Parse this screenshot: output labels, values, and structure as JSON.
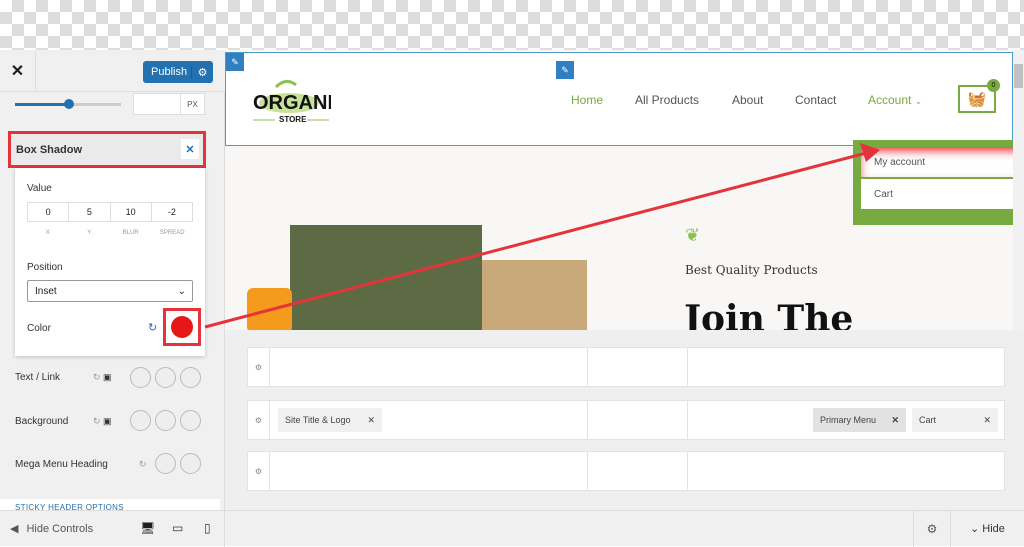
{
  "sidebar": {
    "publish_label": "Publish",
    "px_unit": "PX",
    "slider_value_percent": 50,
    "box_shadow": {
      "title": "Box Shadow",
      "value_label": "Value",
      "values": [
        "0",
        "5",
        "10",
        "-2"
      ],
      "value_labels": [
        "X",
        "Y",
        "BLUR",
        "SPREAD"
      ],
      "position_label": "Position",
      "position_value": "Inset",
      "color_label": "Color",
      "color": "#e81717"
    },
    "rows": [
      {
        "label": "Text / Link"
      },
      {
        "label": "Background"
      },
      {
        "label": "Mega Menu Heading"
      }
    ],
    "sticky_label": "STICKY HEADER OPTIONS"
  },
  "bottom": {
    "hide_controls": "Hide Controls",
    "hide": "Hide"
  },
  "preview": {
    "logo_text": "ORGANIC STORE",
    "nav": [
      {
        "label": "Home",
        "active": true
      },
      {
        "label": "All Products"
      },
      {
        "label": "About"
      },
      {
        "label": "Contact"
      },
      {
        "label": "Account",
        "active": true
      }
    ],
    "cart_count": "0",
    "dropdown": [
      "My account",
      "Cart"
    ],
    "tagline": "Best Quality Products",
    "headline": "Join The",
    "accent": "#77aa40"
  },
  "builder": {
    "chips": {
      "left": "Site Title & Logo",
      "menu": "Primary Menu",
      "cart": "Cart"
    }
  }
}
